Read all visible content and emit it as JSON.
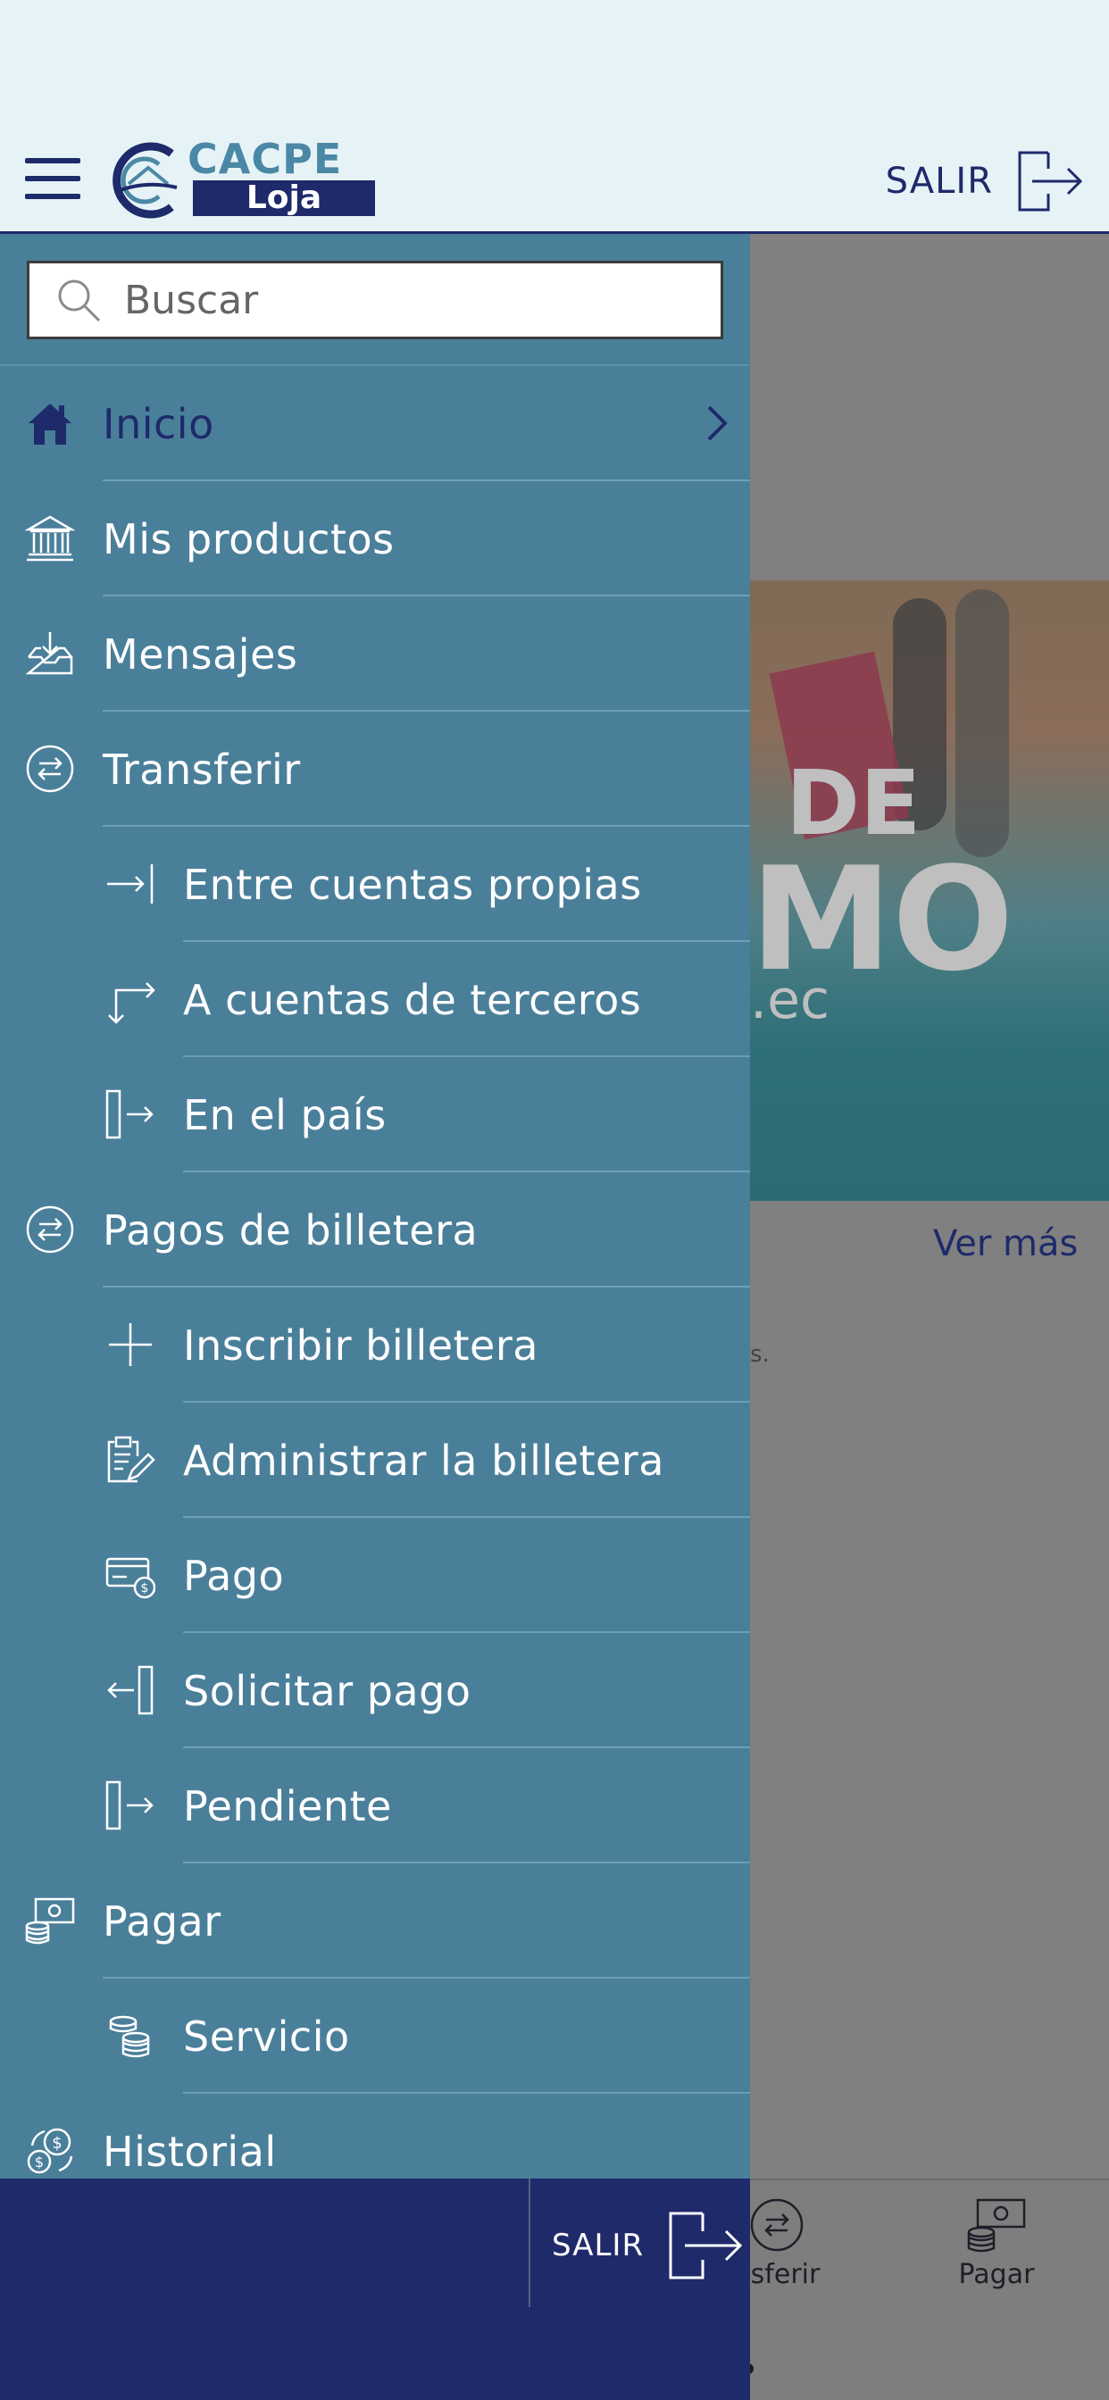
{
  "header": {
    "menu_icon": "hamburger-icon",
    "logo": {
      "word": "CACPE",
      "sub": "Loja"
    },
    "exit_label": "SALIR",
    "exit_icon": "logout-icon"
  },
  "background": {
    "banner_text": [
      "DE",
      "MO",
      ".ec"
    ],
    "see_more": "Ver más",
    "tiny_text": "s.",
    "tabbar": [
      {
        "label": "nsferir",
        "icon": "transfer-icon"
      },
      {
        "label": "Pagar",
        "icon": "pay-icon"
      }
    ]
  },
  "drawer": {
    "search": {
      "placeholder": "Buscar",
      "value": ""
    },
    "items": [
      {
        "label": "Inicio",
        "icon": "home-icon",
        "active": true
      },
      {
        "label": "Mis productos",
        "icon": "bank-icon"
      },
      {
        "label": "Mensajes",
        "icon": "inbox-icon"
      },
      {
        "label": "Transferir",
        "icon": "transfer-icon"
      },
      {
        "label": "Entre cuentas propias",
        "icon": "arrow-to-bar-icon",
        "sub": true
      },
      {
        "label": "A cuentas de terceros",
        "icon": "arrows-corner-icon",
        "sub": true
      },
      {
        "label": "En el país",
        "icon": "exit-box-icon",
        "sub": true
      },
      {
        "label": "Pagos de billetera",
        "icon": "transfer-icon"
      },
      {
        "label": "Inscribir billetera",
        "icon": "plus-icon",
        "sub": true
      },
      {
        "label": "Administrar la billetera",
        "icon": "clipboard-edit-icon",
        "sub": true
      },
      {
        "label": "Pago",
        "icon": "card-payment-icon",
        "sub": true
      },
      {
        "label": "Solicitar pago",
        "icon": "request-box-icon",
        "sub": true
      },
      {
        "label": "Pendiente",
        "icon": "exit-box-icon",
        "sub": true
      },
      {
        "label": "Pagar",
        "icon": "cash-coins-icon"
      },
      {
        "label": "Servicio",
        "icon": "coins-icon",
        "sub": true
      },
      {
        "label": "Historial",
        "icon": "history-money-icon"
      }
    ],
    "footer": {
      "exit_label": "SALIR",
      "exit_icon": "logout-icon"
    }
  },
  "colors": {
    "navy": "#1e2a6a",
    "drawer_bg": "#4a7f9a",
    "header_bg": "#e6f3f6",
    "logo_teal": "#4b88a6"
  }
}
